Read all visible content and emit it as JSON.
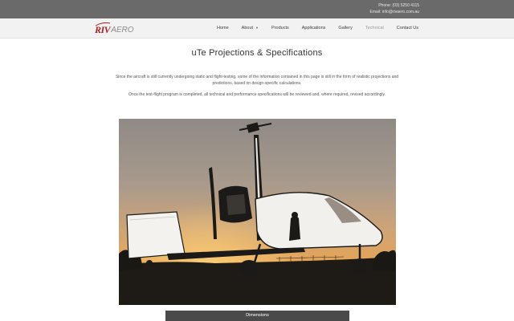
{
  "header": {
    "phone": "Phone: (03) 5250 4115",
    "email": "Email: info@rivaero.com.au"
  },
  "logo": {
    "text_riv": "RIV",
    "text_aero": "AERO"
  },
  "nav": {
    "items": [
      {
        "label": "Home"
      },
      {
        "label": "About"
      },
      {
        "label": "Products"
      },
      {
        "label": "Applications"
      },
      {
        "label": "Gallery"
      },
      {
        "label": "Technical"
      },
      {
        "label": "Contact Us"
      }
    ],
    "active": "Technical"
  },
  "page": {
    "title": "uTe Projections & Specifications",
    "paragraph1": "Since the aircraft is still currently undergoing static and flight-testing, some of the information contained in this page is still in the form of realistic projections and predictions, based on design-specific calculations.",
    "paragraph2": "Once the test-flight program is completed, all technical and performance specifications will be reviewed and, where required, revised accordingly."
  },
  "image": {
    "alt": "uTe gyroplane silhouette at sunset"
  },
  "section": {
    "dimensions_label": "Dimensions"
  }
}
